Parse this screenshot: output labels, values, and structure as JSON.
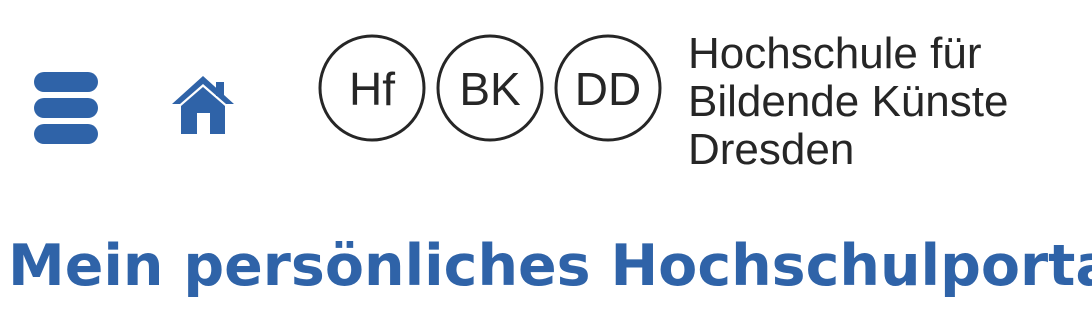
{
  "header": {
    "menu_icon": "hamburger-menu-icon",
    "home_icon": "home-icon",
    "accent_color": "#2f63a8"
  },
  "logo": {
    "circles": [
      "Hf",
      "BK",
      "DD"
    ],
    "text_lines": [
      "Hochschule für",
      "Bildende Künste",
      "Dresden"
    ]
  },
  "page": {
    "title": "Mein persönliches Hochschulportal"
  }
}
